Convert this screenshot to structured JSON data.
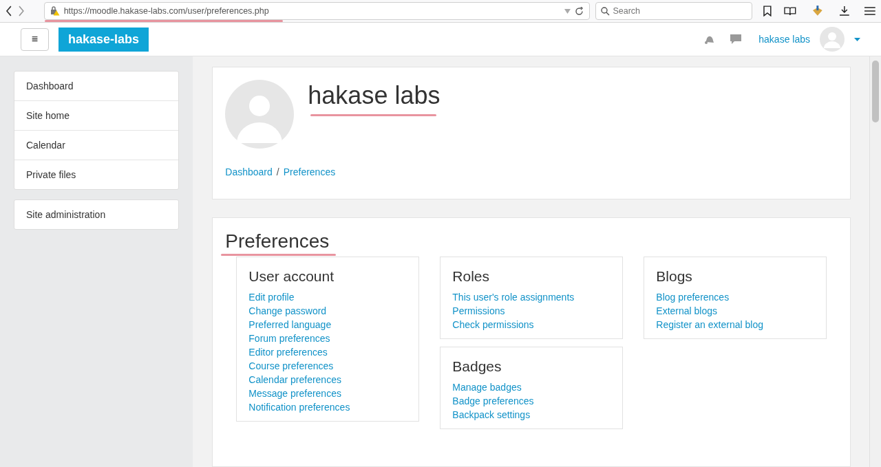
{
  "browser": {
    "url": "https://moodle.hakase-labs.com/user/preferences.php",
    "search_placeholder": "Search"
  },
  "navbar": {
    "menu_glyph": "≡",
    "brand": "hakase-labs",
    "user_name": "hakase labs"
  },
  "sidebar": {
    "groups": [
      [
        "Dashboard",
        "Site home",
        "Calendar",
        "Private files"
      ],
      [
        "Site administration"
      ]
    ]
  },
  "profile": {
    "name": "hakase labs",
    "breadcrumb": [
      "Dashboard",
      "/",
      "Preferences"
    ]
  },
  "preferences": {
    "title": "Preferences",
    "columns": [
      [
        {
          "title": "User account",
          "links": [
            "Edit profile",
            "Change password",
            "Preferred language",
            "Forum preferences",
            "Editor preferences",
            "Course preferences",
            "Calendar preferences",
            "Message preferences",
            "Notification preferences"
          ]
        }
      ],
      [
        {
          "title": "Roles",
          "links": [
            "This user's role assignments",
            "Permissions",
            "Check permissions"
          ]
        },
        {
          "title": "Badges",
          "links": [
            "Manage badges",
            "Badge preferences",
            "Backpack settings"
          ]
        }
      ],
      [
        {
          "title": "Blogs",
          "links": [
            "Blog preferences",
            "External blogs",
            "Register an external blog"
          ]
        }
      ]
    ]
  }
}
